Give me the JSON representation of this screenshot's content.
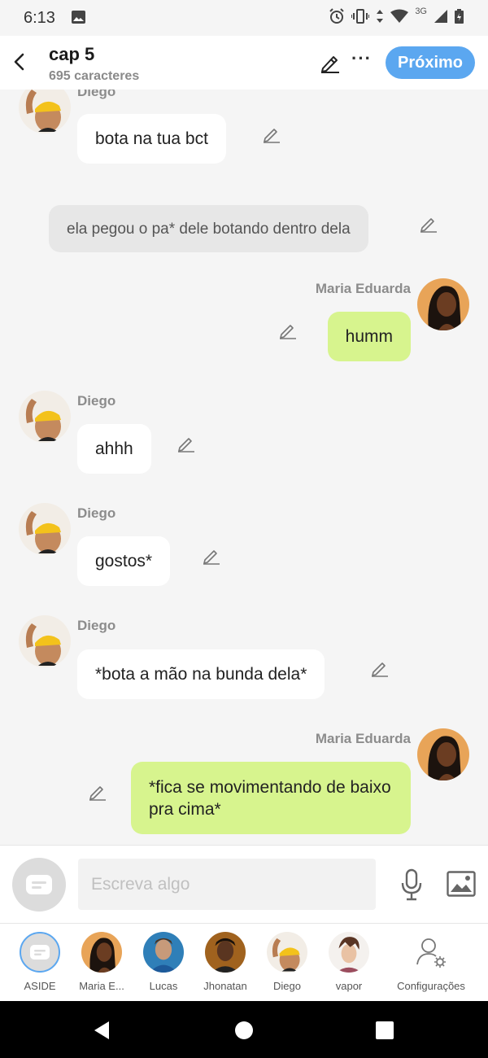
{
  "status_bar": {
    "time": "6:13",
    "network": "3G",
    "icons": [
      "image-icon",
      "alarm-icon",
      "vibrate-icon",
      "data-arrows-icon",
      "wifi-icon",
      "signal-icon",
      "battery-icon"
    ]
  },
  "header": {
    "title": "cap 5",
    "subtitle": "695 caracteres",
    "next_label": "Próximo",
    "accent": "#5ba7f0"
  },
  "messages": [
    {
      "sender": "Diego",
      "text": "bota na tua bct",
      "side": "left"
    },
    {
      "sender": "",
      "text": "ela pegou o pa* dele botando dentro dela",
      "side": "narration"
    },
    {
      "sender": "Maria Eduarda",
      "text": "humm",
      "side": "right"
    },
    {
      "sender": "Diego",
      "text": "ahhh",
      "side": "left"
    },
    {
      "sender": "Diego",
      "text": "gostos*",
      "side": "left"
    },
    {
      "sender": "Diego",
      "text": "*bota a mão na bunda dela*",
      "side": "left"
    },
    {
      "sender": "Maria Eduarda",
      "text": "*fica se movimentando de baixo pra cima*",
      "side": "right"
    }
  ],
  "input": {
    "placeholder": "Escreva algo"
  },
  "characters": [
    {
      "label": "ASIDE"
    },
    {
      "label": "Maria E..."
    },
    {
      "label": "Lucas"
    },
    {
      "label": "Jhonatan"
    },
    {
      "label": "Diego"
    },
    {
      "label": "vapor"
    },
    {
      "label": "Configurações"
    }
  ],
  "colors": {
    "bubble_left": "#ffffff",
    "bubble_right": "#d7f48e",
    "narration": "#e7e7e7"
  }
}
